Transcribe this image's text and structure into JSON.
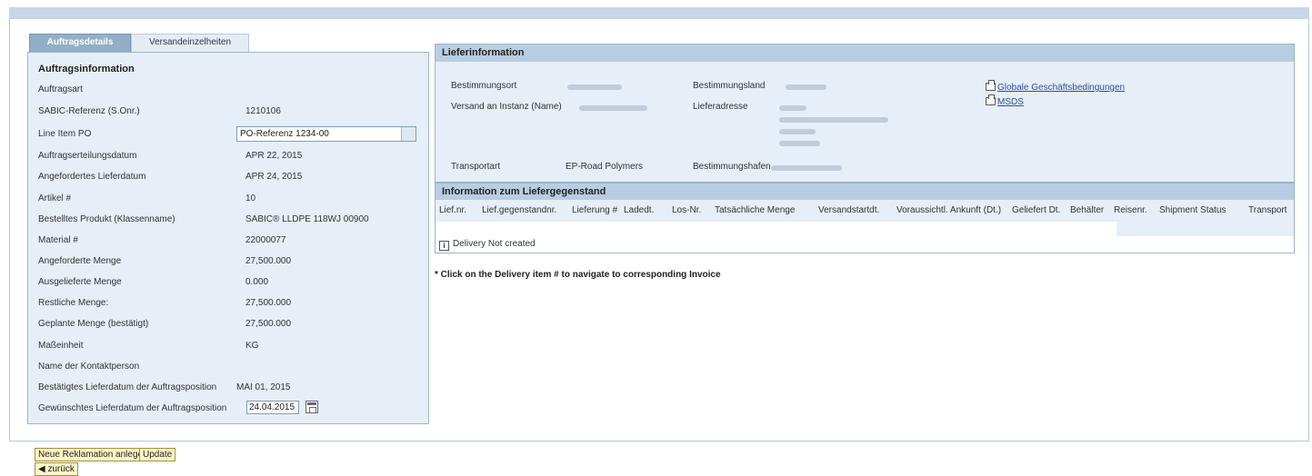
{
  "tabs": [
    {
      "label": "Auftragsdetails",
      "active": true
    },
    {
      "label": "Versandeinzelheiten",
      "active": false
    }
  ],
  "order_info": {
    "heading": "Auftragsinformation",
    "rows": [
      {
        "label": "Auftragsart",
        "value": ""
      },
      {
        "label": "SABIC-Referenz (S.Onr.)",
        "value": "1210106"
      },
      {
        "label": "Line Item PO",
        "input": "PO-Referenz 1234-00"
      },
      {
        "label": "Auftragserteilungsdatum",
        "value": "APR 22, 2015"
      },
      {
        "label": "Angefordertes Lieferdatum",
        "value": "APR 24, 2015"
      },
      {
        "label": "Artikel #",
        "value": "10"
      },
      {
        "label": "Bestelltes Produkt (Klassenname)",
        "value": "SABIC® LLDPE 118WJ 00900"
      },
      {
        "label": "Material #",
        "value": "22000077"
      },
      {
        "label": "Angeforderte Menge",
        "value": "27,500.000"
      },
      {
        "label": "Ausgelieferte Menge",
        "value": "0.000"
      },
      {
        "label": "Restliche Menge:",
        "value": "27,500.000"
      },
      {
        "label": "Geplante Menge (bestätigt)",
        "value": "27,500.000"
      },
      {
        "label": "Maßeinheit",
        "value": "KG"
      },
      {
        "label": "Name der Kontaktperson",
        "value": ""
      },
      {
        "label": "Bestätigtes Lieferdatum der Auftragsposition",
        "value": "MAI 01, 2015"
      },
      {
        "label": "Gewünschtes Lieferdatum der Auftragsposition",
        "date_input": "24.04.2015"
      }
    ]
  },
  "delivery_info": {
    "heading": "Lieferinformation",
    "labels": {
      "bestimmungsort": "Bestimmungsort",
      "bestimmungsland": "Bestimmungsland",
      "versand_an": "Versand an Instanz (Name)",
      "lieferadresse": "Lieferadresse",
      "transportart": "Transportart",
      "transportart_value": "EP-Road Polymers",
      "bestimmungshafen": "Bestimmungshafen"
    },
    "links": [
      {
        "label": "Globale Geschäftsbedingungen",
        "icon": "printer-icon"
      },
      {
        "label": "MSDS",
        "icon": "printer-icon"
      }
    ]
  },
  "delivery_items": {
    "heading": "Information zum Liefergegenstand",
    "columns": [
      "Lief.nr.",
      "Lief.gegenstandnr.",
      "Lieferung #",
      "Ladedt.",
      "Los-Nr.",
      "Tatsächliche Menge",
      "Versandstartdt.",
      "Voraussichtl. Ankunft (Dt.)",
      "Geliefert Dt.",
      "Behälter",
      "Reisenr.",
      "Shipment Status",
      "Transport"
    ],
    "status_text": "Delivery Not created"
  },
  "note": "* Click on the Delivery item # to navigate to corresponding Invoice",
  "buttons": {
    "new_complaint": "Neue Reklamation anlegen",
    "update": "Update",
    "back": "zurück"
  },
  "colors": {
    "panel_bg": "#e6eef7",
    "header_bg": "#b9cde2",
    "button_bg": "#fff5c7",
    "link": "#2a4fa3"
  }
}
